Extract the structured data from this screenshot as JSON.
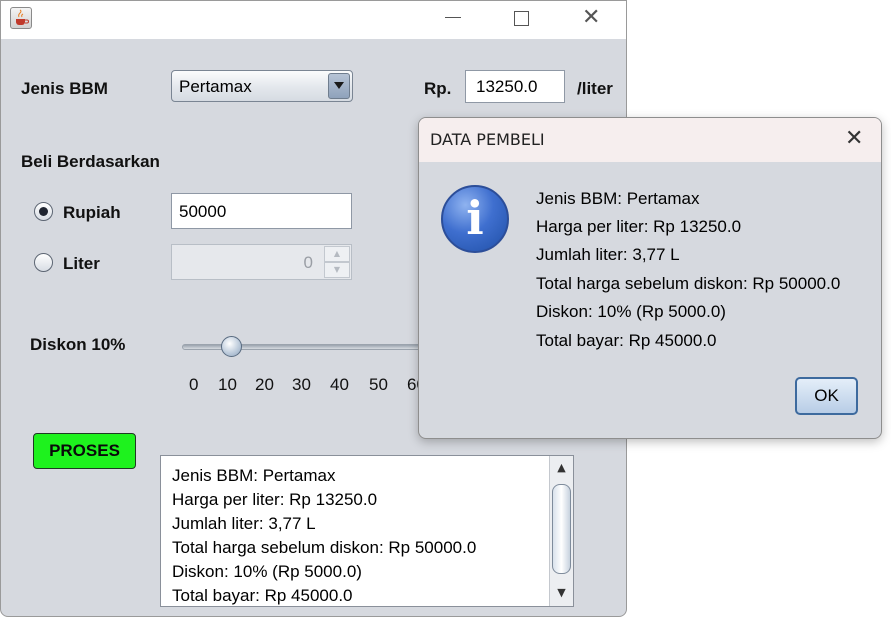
{
  "main": {
    "fuel_type_label": "Jenis BBM",
    "fuel_type_selected": "Pertamax",
    "price_prefix": "Rp.",
    "price_value": "13250.0",
    "price_suffix": "/liter",
    "buy_by_label": "Beli Berdasarkan",
    "option_rupiah": "Rupiah",
    "rupiah_value": "50000",
    "option_liter": "Liter",
    "liter_value": "0",
    "selected_option": "Rupiah",
    "discount_label": "Diskon 10%",
    "discount_percent": 10,
    "slider_ticks": [
      "0",
      "10",
      "20",
      "30",
      "40",
      "50",
      "60"
    ],
    "process_button": "PROSES",
    "output_lines": [
      "Jenis BBM: Pertamax",
      "Harga per liter: Rp 13250.0",
      "Jumlah liter: 3,77 L",
      "Total harga sebelum diskon: Rp 50000.0",
      "Diskon: 10% (Rp 5000.0)",
      "Total bayar: Rp 45000.0"
    ]
  },
  "dialog": {
    "title": "DATA PEMBELI",
    "lines": [
      "Jenis BBM: Pertamax",
      "Harga per liter: Rp 13250.0",
      "Jumlah liter: 3,77 L",
      "Total harga sebelum diskon: Rp 50000.0",
      "Diskon: 10% (Rp 5000.0)",
      "Total bayar: Rp 45000.0"
    ],
    "ok_label": "OK",
    "icon": "info-icon"
  },
  "colors": {
    "window_bg": "#d6d9df",
    "process_button": "#1ef21e",
    "dialog_title_bg": "#f6eeee",
    "info_icon": "#3f6fcf"
  }
}
